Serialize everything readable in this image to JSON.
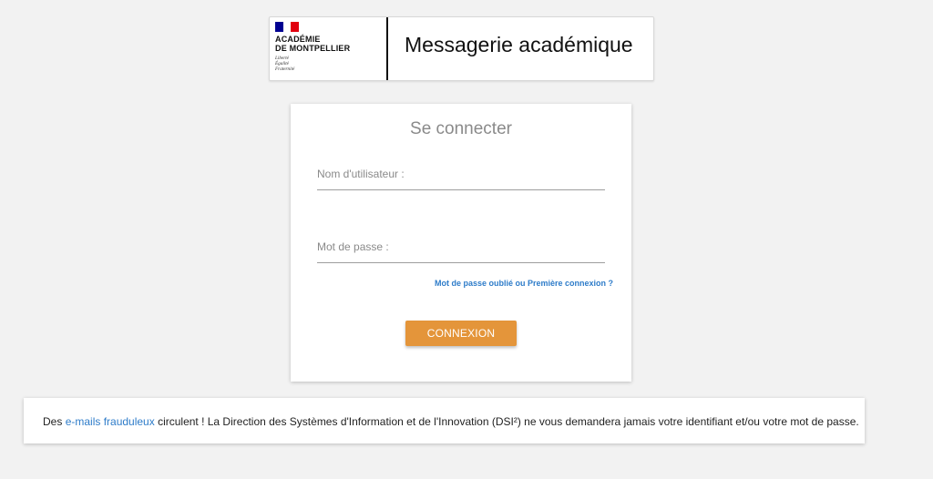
{
  "header": {
    "academy_line1": "ACADÉMIE",
    "academy_line2": "DE MONTPELLIER",
    "motto_line1": "Liberté",
    "motto_line2": "Égalité",
    "motto_line3": "Fraternité",
    "title": "Messagerie académique"
  },
  "login": {
    "title": "Se connecter",
    "username_label": "Nom d'utilisateur :",
    "username_value": "",
    "password_label": "Mot de passe :",
    "password_value": "",
    "forgot_link": "Mot de passe oublié ou Première connexion ?",
    "submit_label": "CONNEXION"
  },
  "notice": {
    "prefix": "Des ",
    "link": "e-mails frauduleux",
    "suffix": " circulent ! La Direction des Systèmes d'Information et de l'Innovation (DSI²) ne vous demandera jamais votre identifiant et/ou votre mot de passe."
  },
  "colors": {
    "background": "#f2f2f2",
    "button": "#e4953a",
    "link": "#2e7cc9",
    "flag_blue": "#000091",
    "flag_white": "#ffffff",
    "flag_red": "#e1000f"
  }
}
